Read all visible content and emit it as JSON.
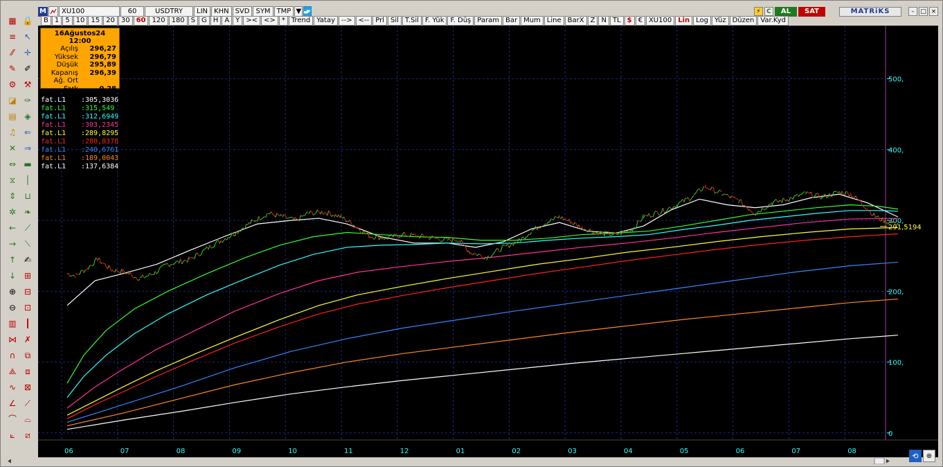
{
  "topbar": {
    "logo": "M",
    "symbol": "XU100",
    "period": "60",
    "currency": "USDTRY",
    "cells": [
      "LIN",
      "KHN",
      "SVD",
      "SYM",
      "TMP"
    ],
    "buy_label": "AL",
    "sell_label": "SAT",
    "brand": "MATRiKS"
  },
  "toolbar2": {
    "items": [
      "B",
      "1",
      "5",
      "10",
      "15",
      "20",
      "30",
      "60",
      "120",
      "180",
      "S",
      "G",
      "H",
      "A",
      "Y",
      "><",
      "<>",
      "*",
      "Trend",
      "Yatay",
      "-->",
      "<--",
      "Prl",
      "Sil",
      "T.Sil",
      "F. Yük",
      "F. Düş",
      "Param",
      "Bar",
      "Mum",
      "Line",
      "BarX",
      "Z",
      "N",
      "TL",
      "$",
      "€",
      "XU100",
      "Lin",
      "Log",
      "Yüz",
      "Düzen",
      "Var.Kyd"
    ],
    "selected": "60",
    "red_items": [
      "$",
      "Lin"
    ]
  },
  "infobox": {
    "date": "16Ağustos24 12:00",
    "rows": [
      {
        "label": "Açılış",
        "value": "296,27"
      },
      {
        "label": "Yüksek",
        "value": "296,79"
      },
      {
        "label": "Düşük",
        "value": "295,89"
      },
      {
        "label": "Kapanış",
        "value": "296,39"
      },
      {
        "label": "Ağ. Ort",
        "value": ""
      },
      {
        "label": "Fark",
        "value": "0,28"
      }
    ]
  },
  "legend": [
    {
      "name": "fat.L1",
      "value": ":305,3036",
      "color": "#ffffff"
    },
    {
      "name": "fat.L1",
      "value": ":315,549",
      "color": "#33ff33"
    },
    {
      "name": "fat.L1",
      "value": ":312,6949",
      "color": "#33ffff"
    },
    {
      "name": "fat.L1",
      "value": ":303,2345",
      "color": "#ff3399"
    },
    {
      "name": "fat.L1",
      "value": ":289,8295",
      "color": "#ffff33"
    },
    {
      "name": "fat.L1",
      "value": ":280,8378",
      "color": "#ff2222"
    },
    {
      "name": "fat.L1",
      "value": ":240,6761",
      "color": "#3388ff"
    },
    {
      "name": "fat.L1",
      "value": ":189,0043",
      "color": "#ff8822"
    },
    {
      "name": "fat.L1",
      "value": ":137,6384",
      "color": "#ffffff"
    }
  ],
  "price_tag": "291,5194",
  "chart_data": {
    "type": "line",
    "x_ticks": [
      "06",
      "07",
      "08",
      "09",
      "10",
      "11",
      "12",
      "01",
      "02",
      "03",
      "04",
      "05",
      "06",
      "07",
      "08"
    ],
    "y_ticks": [
      "0",
      "100,",
      "200,",
      "300,",
      "400,",
      "500,"
    ],
    "ylim": [
      -10,
      575
    ],
    "grid": true,
    "price_series": {
      "name": "XU100",
      "x": [
        0,
        0.15,
        0.35,
        0.55,
        0.8,
        1.0,
        1.3,
        1.55,
        1.8,
        2.2,
        2.6,
        3.0,
        3.3,
        3.6,
        3.85,
        4.1,
        4.3,
        4.6,
        4.9,
        5.1,
        5.4,
        5.7,
        6.0,
        6.4,
        6.8,
        7.0,
        7.2,
        7.5,
        7.8,
        8.1,
        8.3,
        8.5,
        8.8,
        9.0,
        9.2,
        9.5,
        9.8,
        10.1,
        10.3,
        10.6,
        10.9,
        11.2,
        11.4,
        11.7,
        12.0,
        12.3,
        12.6,
        12.9,
        13.2,
        13.5,
        13.8,
        14.0,
        14.2,
        14.45,
        14.65,
        14.85
      ],
      "values": [
        225,
        222,
        232,
        245,
        230,
        228,
        218,
        225,
        238,
        245,
        265,
        282,
        298,
        310,
        305,
        300,
        310,
        312,
        305,
        295,
        278,
        275,
        280,
        277,
        272,
        273,
        255,
        248,
        262,
        272,
        285,
        295,
        305,
        298,
        290,
        282,
        280,
        287,
        305,
        312,
        322,
        335,
        348,
        338,
        328,
        310,
        325,
        330,
        338,
        333,
        340,
        338,
        325,
        305,
        298,
        296
      ]
    },
    "series": [
      {
        "color": "#ffffff",
        "x": [
          0,
          0.5,
          1.0,
          1.6,
          2.2,
          2.8,
          3.4,
          4.0,
          4.5,
          5.0,
          5.6,
          6.2,
          6.8,
          7.3,
          7.8,
          8.3,
          8.8,
          9.3,
          9.8,
          10.3,
          10.8,
          11.3,
          11.8,
          12.3,
          12.8,
          13.3,
          13.8,
          14.3,
          14.85
        ],
        "values": [
          180,
          215,
          225,
          238,
          258,
          277,
          295,
          300,
          303,
          295,
          277,
          268,
          268,
          262,
          270,
          288,
          297,
          285,
          282,
          292,
          315,
          330,
          322,
          318,
          322,
          332,
          337,
          325,
          305
        ]
      },
      {
        "color": "#33ff33",
        "x": [
          0,
          0.3,
          0.7,
          1.2,
          1.8,
          2.5,
          3.2,
          3.8,
          4.4,
          5.0,
          5.6,
          6.2,
          6.8,
          7.4,
          8.0,
          8.6,
          9.2,
          9.8,
          10.4,
          11.0,
          11.6,
          12.2,
          12.8,
          13.4,
          14.0,
          14.5,
          14.85
        ],
        "values": [
          70,
          110,
          145,
          175,
          200,
          225,
          248,
          265,
          277,
          283,
          280,
          277,
          276,
          272,
          272,
          275,
          280,
          282,
          285,
          292,
          300,
          308,
          313,
          318,
          322,
          320,
          316
        ]
      },
      {
        "color": "#33ffff",
        "x": [
          0,
          0.3,
          0.7,
          1.2,
          1.8,
          2.5,
          3.2,
          3.8,
          4.4,
          5.0,
          5.6,
          6.2,
          6.8,
          7.4,
          8.0,
          8.6,
          9.2,
          9.8,
          10.4,
          11.0,
          11.6,
          12.2,
          12.8,
          13.4,
          14.0,
          14.5,
          14.85
        ],
        "values": [
          50,
          80,
          110,
          140,
          168,
          195,
          218,
          237,
          252,
          262,
          265,
          266,
          268,
          267,
          268,
          272,
          275,
          277,
          280,
          287,
          293,
          300,
          305,
          310,
          314,
          314,
          313
        ]
      },
      {
        "color": "#ff3399",
        "x": [
          0,
          0.5,
          1.0,
          1.6,
          2.3,
          3.0,
          3.8,
          4.5,
          5.2,
          6.0,
          6.8,
          7.6,
          8.4,
          9.2,
          10.0,
          10.8,
          11.6,
          12.4,
          13.2,
          14.0,
          14.85
        ],
        "values": [
          35,
          65,
          90,
          118,
          145,
          172,
          197,
          215,
          227,
          235,
          242,
          248,
          255,
          262,
          268,
          275,
          283,
          290,
          297,
          302,
          303
        ]
      },
      {
        "color": "#ffff33",
        "x": [
          0,
          0.5,
          1.0,
          1.6,
          2.3,
          3.0,
          3.8,
          4.5,
          5.2,
          6.0,
          6.8,
          7.6,
          8.4,
          9.2,
          10.0,
          10.8,
          11.6,
          12.4,
          13.2,
          14.0,
          14.85
        ],
        "values": [
          25,
          45,
          65,
          88,
          112,
          135,
          160,
          180,
          195,
          207,
          218,
          228,
          238,
          246,
          255,
          262,
          270,
          277,
          283,
          288,
          290
        ]
      },
      {
        "color": "#ff2222",
        "x": [
          0,
          0.5,
          1.0,
          1.6,
          2.3,
          3.0,
          3.8,
          4.5,
          5.2,
          6.0,
          6.8,
          7.6,
          8.4,
          9.2,
          10.0,
          10.8,
          11.6,
          12.4,
          13.2,
          14.0,
          14.85
        ],
        "values": [
          20,
          40,
          58,
          80,
          104,
          127,
          150,
          168,
          182,
          194,
          205,
          215,
          225,
          234,
          243,
          251,
          259,
          266,
          272,
          277,
          281
        ]
      },
      {
        "color": "#3388ff",
        "x": [
          0,
          1.0,
          2.0,
          3.0,
          4.0,
          5.0,
          6.0,
          7.0,
          8.0,
          9.0,
          10.0,
          11.0,
          12.0,
          13.0,
          14.0,
          14.85
        ],
        "values": [
          15,
          40,
          65,
          92,
          115,
          133,
          148,
          160,
          172,
          183,
          194,
          205,
          216,
          227,
          236,
          241
        ]
      },
      {
        "color": "#ff8822",
        "x": [
          0,
          1.0,
          2.0,
          3.0,
          4.0,
          5.0,
          6.0,
          7.0,
          8.0,
          9.0,
          10.0,
          11.0,
          12.0,
          13.0,
          14.0,
          14.85
        ],
        "values": [
          10,
          28,
          48,
          68,
          85,
          100,
          112,
          122,
          132,
          142,
          151,
          160,
          168,
          176,
          184,
          189
        ]
      },
      {
        "color": "#ffffff",
        "x": [
          0,
          1.0,
          2.0,
          3.0,
          4.0,
          5.0,
          6.0,
          7.0,
          8.0,
          9.0,
          10.0,
          11.0,
          12.0,
          13.0,
          14.0,
          14.85
        ],
        "values": [
          5,
          18,
          30,
          43,
          55,
          65,
          74,
          82,
          90,
          98,
          105,
          112,
          119,
          126,
          133,
          138
        ]
      }
    ]
  }
}
